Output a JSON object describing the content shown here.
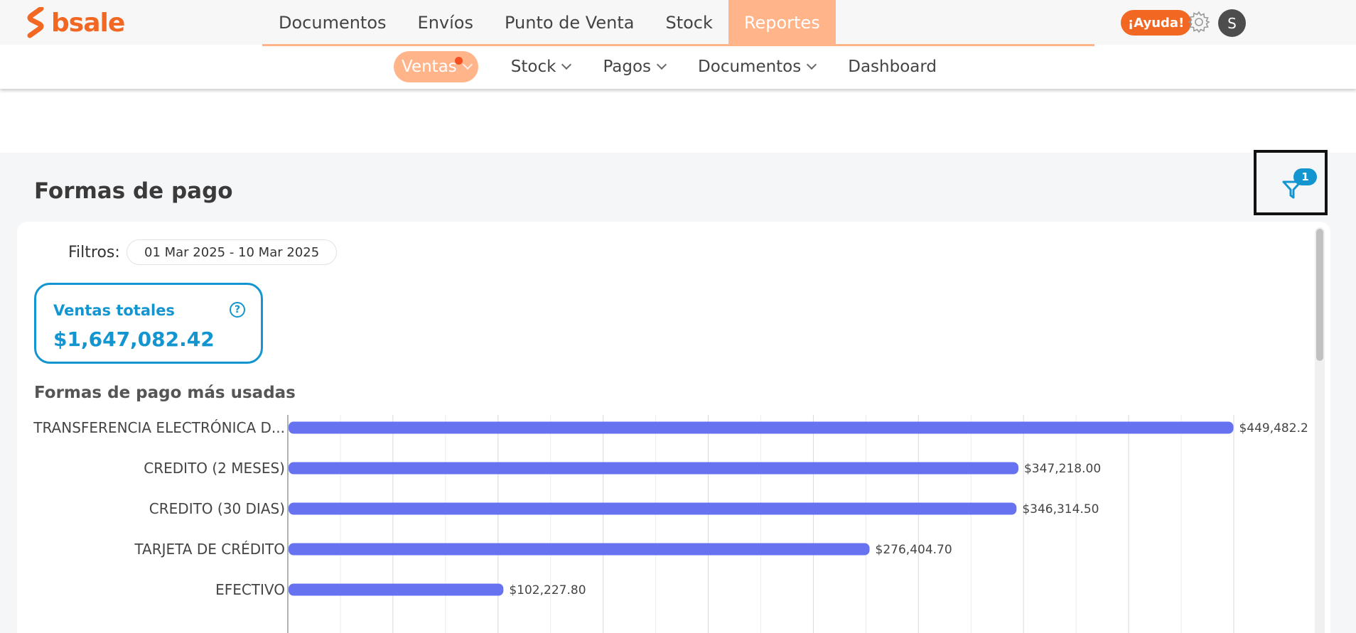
{
  "brand": {
    "name": "bsale",
    "color": "#f26722"
  },
  "main_nav": [
    {
      "label": "Documentos",
      "active": false
    },
    {
      "label": "Envíos",
      "active": false
    },
    {
      "label": "Punto de Venta",
      "active": false
    },
    {
      "label": "Stock",
      "active": false
    },
    {
      "label": "Reportes",
      "active": true
    }
  ],
  "header_right": {
    "help_label": "¡Ayuda!",
    "avatar_initial": "S"
  },
  "sub_nav": [
    {
      "label": "Ventas",
      "active": true,
      "has_dropdown": true,
      "notification": true
    },
    {
      "label": "Stock",
      "active": false,
      "has_dropdown": true
    },
    {
      "label": "Pagos",
      "active": false,
      "has_dropdown": true
    },
    {
      "label": "Documentos",
      "active": false,
      "has_dropdown": true
    },
    {
      "label": "Dashboard",
      "active": false,
      "has_dropdown": false
    }
  ],
  "page": {
    "title": "Formas de pago",
    "filter_count": "1",
    "filters_label": "Filtros:",
    "date_range": "01 Mar 2025 - 10 Mar 2025",
    "kpi": {
      "label": "Ventas totales",
      "help": "?",
      "value": "$1,647,082.42"
    },
    "chart_title": "Formas de pago más usadas"
  },
  "colors": {
    "accent": "#ffb48a",
    "primary": "#1395d0",
    "bar": "#6772f0"
  },
  "chart_data": {
    "type": "bar",
    "orientation": "horizontal",
    "categories": [
      "TRANSFERENCIA ELECTRÓNICA D...",
      "CREDITO (2 MESES)",
      "CREDITO (30 DIAS)",
      "TARJETA DE CRÉDITO",
      "EFECTIVO"
    ],
    "values": [
      449482.2,
      347218.0,
      346314.5,
      276404.7,
      102227.8
    ],
    "value_labels": [
      "$449,482.2",
      "$347,218.00",
      "$346,314.50",
      "$276,404.70",
      "$102,227.80"
    ],
    "xlim": [
      0,
      450000
    ],
    "grid": true
  }
}
